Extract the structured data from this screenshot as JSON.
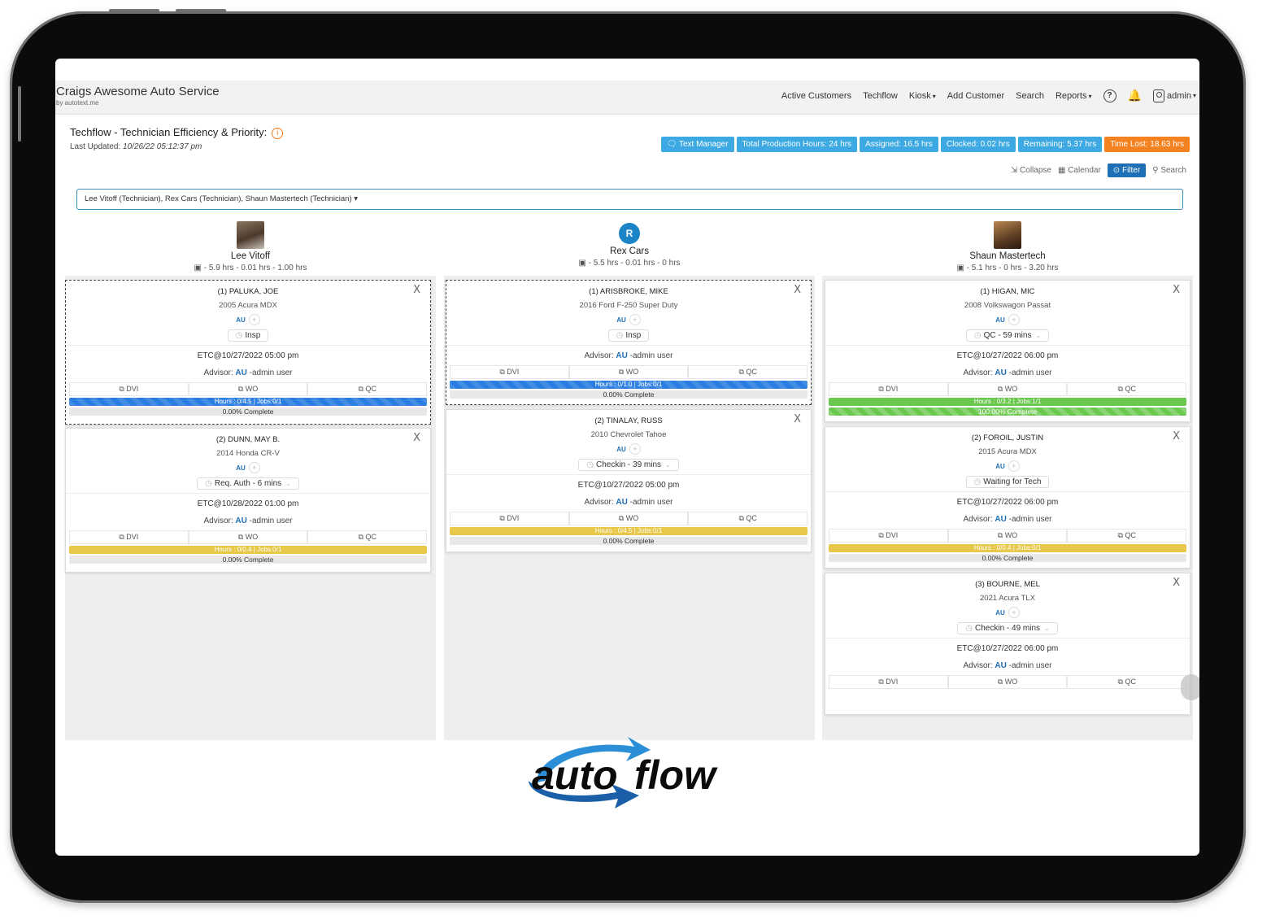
{
  "app": {
    "brand": "Craigs Awesome Auto Service",
    "brand_sub": "by autotext.me"
  },
  "nav": {
    "items": [
      "Active Customers",
      "Techflow",
      "Kiosk",
      "Add Customer",
      "Search",
      "Reports"
    ],
    "user": "admin"
  },
  "page": {
    "title": "Techflow - Technician Efficiency & Priority:",
    "updated_label": "Last Updated:",
    "updated_value": "10/26/22 05:12:37 pm"
  },
  "pills": {
    "text_manager": "Text Manager",
    "total": "Total Production Hours: 24 hrs",
    "assigned": "Assigned: 16.5 hrs",
    "clocked": "Clocked: 0.02 hrs",
    "remaining": "Remaining: 5.37 hrs",
    "lost": "Time Lost: 18.63 hrs"
  },
  "toolbar": {
    "collapse": "Collapse",
    "calendar": "Calendar",
    "filter": "Filter",
    "search": "Search"
  },
  "tech_select": "Lee Vitoff (Technician), Rex Cars (Technician), Shaun Mastertech (Technician)",
  "techs": [
    {
      "name": "Lee Vitoff",
      "stats": "- 5.9 hrs  - 0.01 hrs  - 1.00 hrs"
    },
    {
      "name": "Rex Cars",
      "initial": "R",
      "stats": "- 5.5 hrs  - 0.01 hrs  - 0 hrs"
    },
    {
      "name": "Shaun Mastertech",
      "stats": "- 5.1 hrs  - 0 hrs  - 3.20 hrs"
    }
  ],
  "labels": {
    "au": "AU",
    "advisor": "Advisor:",
    "advisor_name": "-admin user",
    "dvi": "DVI",
    "wo": "WO",
    "qc": "QC",
    "close": "X"
  },
  "cards": [
    {
      "name": "(1) PALUKA, JOE",
      "vehicle": "2005 Acura MDX",
      "status": "Insp",
      "etc": "ETC@10/27/2022 05:00 pm",
      "hours": "Hours : 0/4.5   |   Jobs:0/1",
      "complete": "0.00% Complete",
      "progress": 0
    },
    {
      "name": "(2) DUNN, MAY B.",
      "vehicle": "2014 Honda CR-V",
      "status": "Req. Auth - 6 mins",
      "etc": "ETC@10/28/2022 01:00 pm",
      "hours": "Hours : 0/0.4   |   Jobs:0/1",
      "complete": "0.00% Complete",
      "progress": 0
    },
    {
      "name": "(1) ARISBROKE, MIKE",
      "vehicle": "2016 Ford F-250 Super Duty",
      "status": "Insp",
      "hours": "Hours : 0/1.0   |   Jobs:0/1",
      "complete": "0.00% Complete",
      "progress": 0
    },
    {
      "name": "(2) TINALAY, RUSS",
      "vehicle": "2010 Chevrolet Tahoe",
      "status": "Checkin - 39 mins",
      "etc": "ETC@10/27/2022 05:00 pm",
      "hours": "Hours : 0/4.5   |   Jobs:0/1",
      "complete": "0.00% Complete",
      "progress": 0
    },
    {
      "name": "(1) HIGAN, MIC",
      "vehicle": "2008 Volkswagon Passat",
      "status": "QC - 59 mins",
      "etc": "ETC@10/27/2022 06:00 pm",
      "hours": "Hours : 0/3.2   |   Jobs:1/1",
      "complete": "100.00% Complete",
      "progress": 1
    },
    {
      "name": "(2) FOROIL, JUSTIN",
      "vehicle": "2015 Acura MDX",
      "status": "Waiting for Tech",
      "etc": "ETC@10/27/2022 06:00 pm",
      "hours": "Hours : 0/0.4   |   Jobs:0/1",
      "complete": "0.00% Complete",
      "progress": 0
    },
    {
      "name": "(3) BOURNE, MEL",
      "vehicle": "2021 Acura TLX",
      "status": "Checkin - 49 mins",
      "etc": "ETC@10/27/2022 06:00 pm"
    }
  ],
  "logo": {
    "part1": "auto",
    "part2": "flow"
  },
  "colors": {
    "blue": "#2a7de1",
    "pill": "#3ca9e2",
    "orange": "#f58220",
    "yellow": "#e7c84a",
    "green": "#6bc84f",
    "brand_blue": "#1e6fb5"
  }
}
